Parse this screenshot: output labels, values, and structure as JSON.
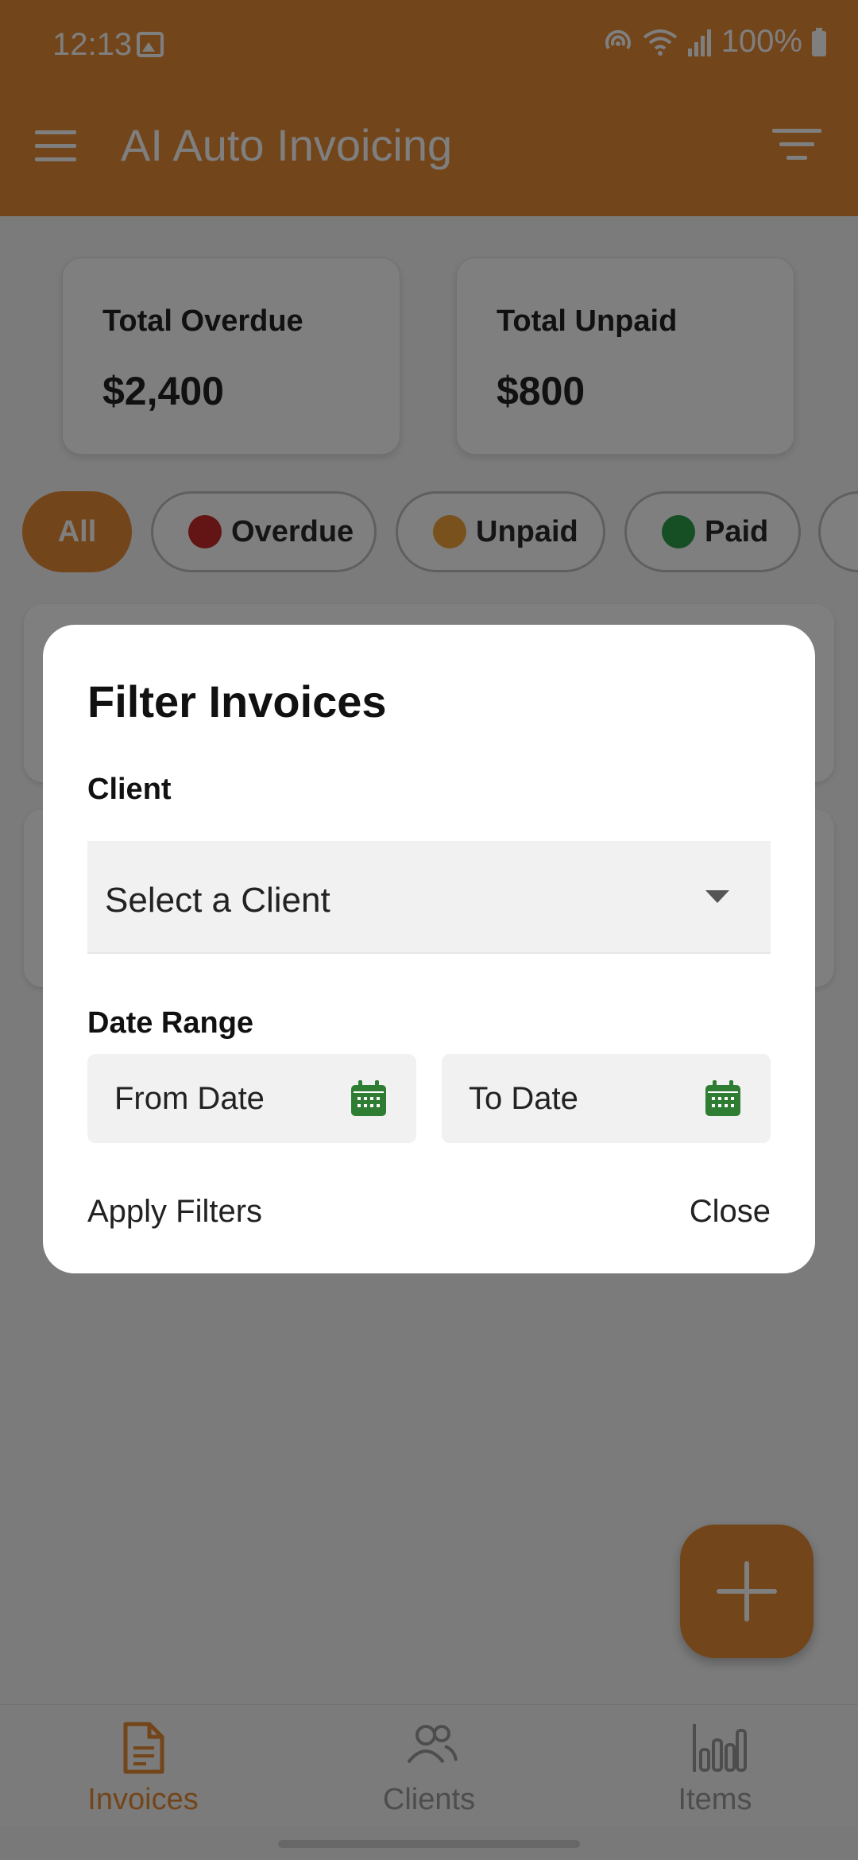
{
  "status": {
    "time": "12:13",
    "battery": "100%"
  },
  "app": {
    "title": "AI Auto Invoicing"
  },
  "summary": [
    {
      "label": "Total Overdue",
      "amount": "$2,400"
    },
    {
      "label": "Total Unpaid",
      "amount": "$800"
    }
  ],
  "chips": [
    {
      "label": "All"
    },
    {
      "label": "Overdue",
      "color": "#c62828"
    },
    {
      "label": "Unpaid",
      "color": "#f2a33a"
    },
    {
      "label": "Paid",
      "color": "#2e9e4a"
    }
  ],
  "dialog": {
    "title": "Filter Invoices",
    "client_label": "Client",
    "client_value": "Select a Client",
    "date_label": "Date Range",
    "from_date": "From Date",
    "to_date": "To Date",
    "apply": "Apply Filters",
    "close": "Close"
  },
  "nav": [
    {
      "label": "Invoices",
      "icon": "document-icon",
      "active": true
    },
    {
      "label": "Clients",
      "icon": "people-icon",
      "active": false
    },
    {
      "label": "Items",
      "icon": "bar-chart-icon",
      "active": false
    }
  ],
  "colors": {
    "accent": "#e68a35",
    "calendar": "#2e7d32"
  }
}
